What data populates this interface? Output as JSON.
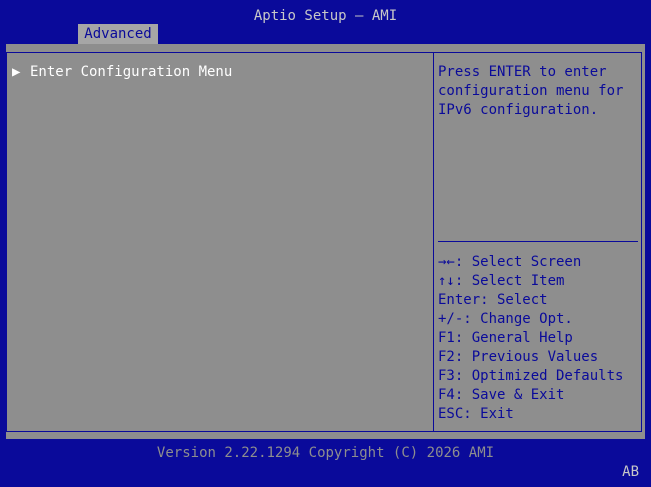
{
  "header": {
    "title": "Aptio Setup – AMI",
    "tabs": [
      {
        "label": "Advanced",
        "active": true
      }
    ]
  },
  "main": {
    "items": [
      {
        "arrow": "▶",
        "label": "Enter Configuration Menu"
      }
    ]
  },
  "help": {
    "lines": [
      "Press ENTER to enter",
      "configuration menu for",
      "IPv6 configuration."
    ]
  },
  "keys": [
    "→←: Select Screen",
    "↑↓: Select Item",
    "Enter: Select",
    "+/-: Change Opt.",
    "F1: General Help",
    "F2: Previous Values",
    "F3: Optimized Defaults",
    "F4: Save & Exit",
    "ESC: Exit"
  ],
  "footer": {
    "version": "Version 2.22.1294 Copyright (C) 2026 AMI",
    "badge": "AB"
  },
  "colors": {
    "bios_blue": "#0a0a9a",
    "panel_gray": "#8e8e8e",
    "tab_gray": "#a6a6a6",
    "highlight_text": "#ffffff"
  }
}
